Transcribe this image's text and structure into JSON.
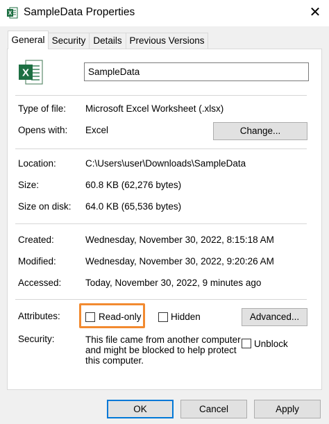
{
  "window": {
    "title": "SampleData Properties",
    "close_glyph": "✕"
  },
  "tabs": [
    {
      "label": "General",
      "active": true
    },
    {
      "label": "Security",
      "active": false
    },
    {
      "label": "Details",
      "active": false
    },
    {
      "label": "Previous Versions",
      "active": false
    }
  ],
  "file": {
    "name": "SampleData",
    "icon": "excel-icon"
  },
  "info": {
    "type_label": "Type of file:",
    "type_value": "Microsoft Excel Worksheet (.xlsx)",
    "opens_label": "Opens with:",
    "opens_value": "Excel",
    "change_button": "Change...",
    "location_label": "Location:",
    "location_value": "C:\\Users\\user\\Downloads\\SampleData",
    "size_label": "Size:",
    "size_value": "60.8 KB (62,276 bytes)",
    "size_disk_label": "Size on disk:",
    "size_disk_value": "64.0 KB (65,536 bytes)",
    "created_label": "Created:",
    "created_value": "Wednesday, November 30, 2022, 8:15:18 AM",
    "modified_label": "Modified:",
    "modified_value": "Wednesday, November 30, 2022, 9:20:26 AM",
    "accessed_label": "Accessed:",
    "accessed_value": "Today, November 30, 2022, 9 minutes ago"
  },
  "attributes": {
    "label": "Attributes:",
    "readonly_label": "Read-only",
    "readonly_checked": false,
    "hidden_label": "Hidden",
    "hidden_checked": false,
    "advanced_button": "Advanced..."
  },
  "security": {
    "label": "Security:",
    "text": "This file came from another computer and might be blocked to help protect this computer.",
    "unblock_label": "Unblock",
    "unblock_checked": false
  },
  "footer": {
    "ok": "OK",
    "cancel": "Cancel",
    "apply": "Apply"
  },
  "colors": {
    "accent": "#0078d7",
    "highlight": "#f28a30",
    "excel_green": "#1d6f42"
  }
}
